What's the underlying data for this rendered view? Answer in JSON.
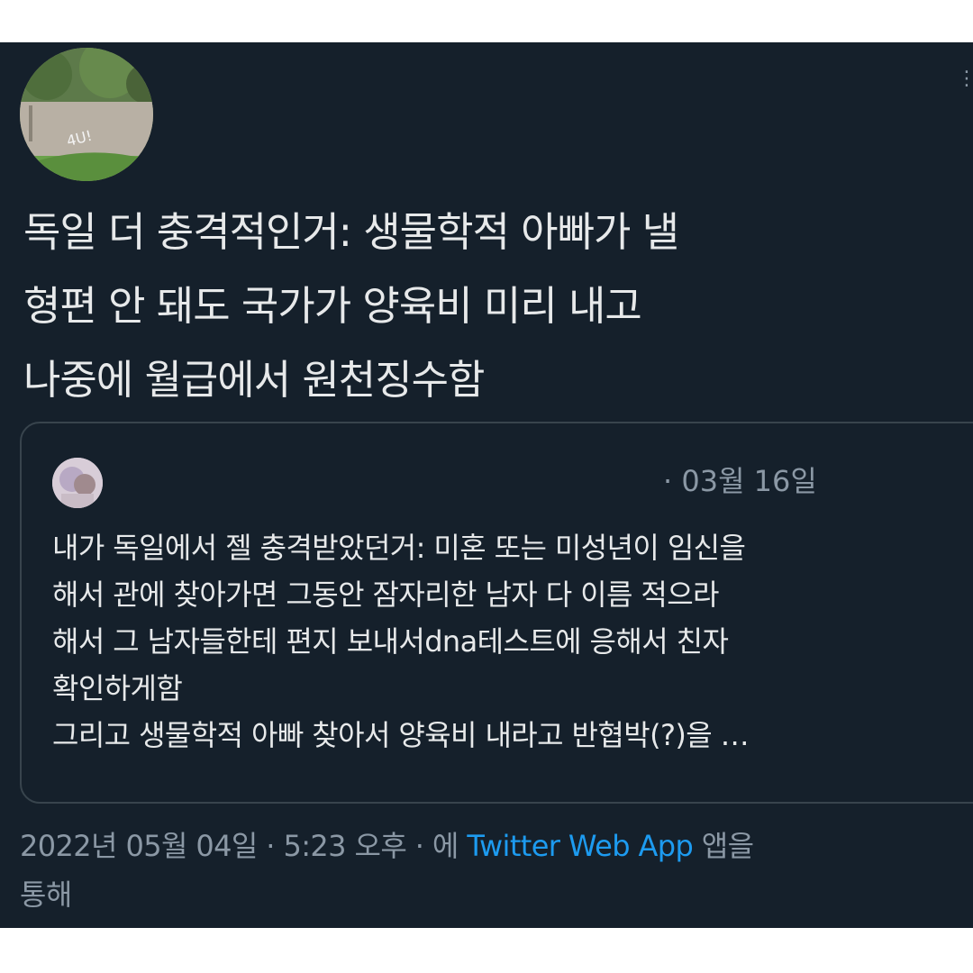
{
  "tweet": {
    "text_lines": [
      "독일 더 충격적인거: 생물학적 아빠가 낼",
      "형편 안 돼도 국가가 양육비 미리 내고",
      "나중에 월급에서 원천징수함"
    ],
    "more_icon": "more-vertical-icon"
  },
  "quote": {
    "date": "· 03월 16일",
    "text_lines": [
      "내가 독일에서 젤 충격받았던거: 미혼 또는 미성년이 임신을",
      "해서 관에 찾아가면 그동안 잠자리한 남자 다 이름 적으라",
      "해서 그 남자들한테 편지 보내서dna테스트에 응해서 친자",
      "확인하게함",
      "그리고 생물학적 아빠 찾아서 양육비 내라고 반협박(?)을 …"
    ]
  },
  "meta": {
    "timestamp": "2022년 05월 04일 · 5:23 오후 · 에",
    "source": "Twitter Web App",
    "suffix": "앱을",
    "line2": "통해"
  },
  "colors": {
    "background": "#15202b",
    "text": "#e7e9ea",
    "muted": "#8b98a5",
    "link": "#1d9bf0",
    "border": "#38444d"
  }
}
